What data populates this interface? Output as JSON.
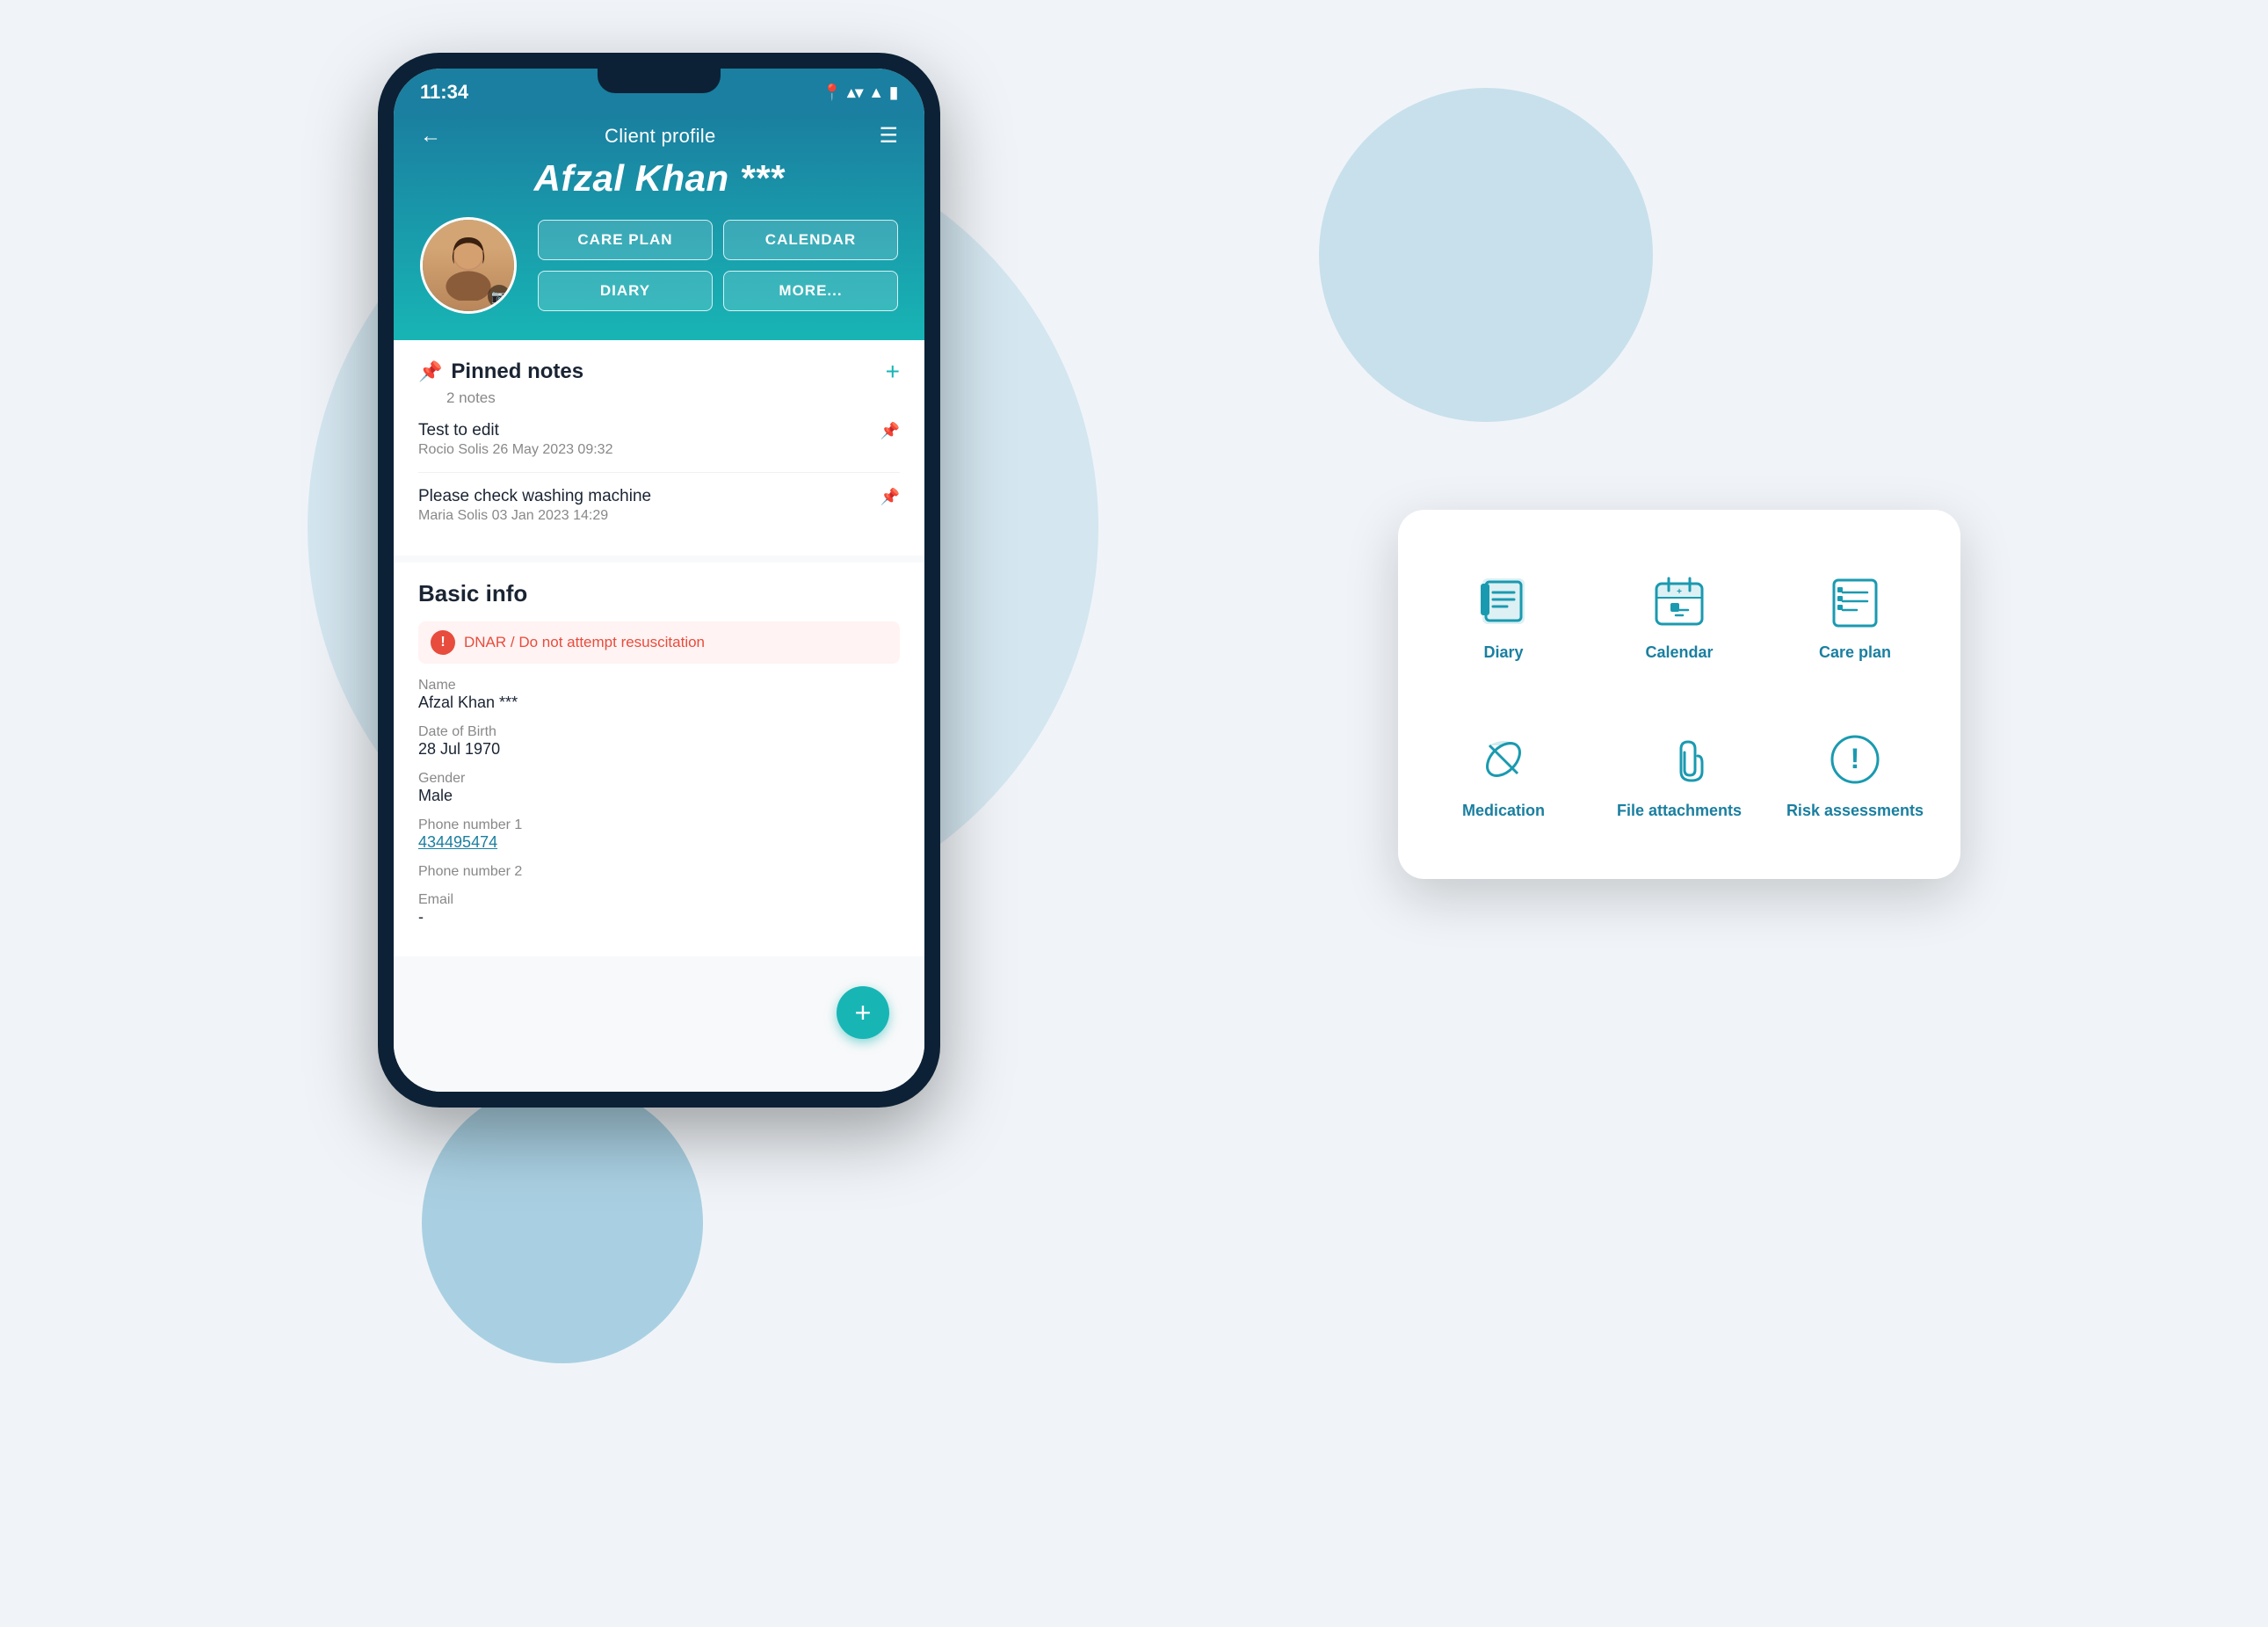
{
  "background": {
    "color": "#e8f2f8"
  },
  "status_bar": {
    "time": "11:34",
    "icons": [
      "📍",
      "▾",
      "📶",
      "🔋"
    ]
  },
  "header": {
    "back_label": "←",
    "title": "Client profile",
    "menu_label": "☰",
    "client_name": "Afzal Khan ***"
  },
  "action_buttons": {
    "care_plan": "CARE PLAN",
    "calendar": "CALENDAR",
    "diary": "DIARY",
    "more": "MORE..."
  },
  "pinned_notes": {
    "section_title": "Pinned notes",
    "subtitle": "2 notes",
    "notes": [
      {
        "title": "Test to edit",
        "meta": "Rocio Solis 26 May 2023 09:32"
      },
      {
        "title": "Please check washing machine",
        "meta": "Maria Solis 03 Jan 2023 14:29"
      }
    ]
  },
  "basic_info": {
    "section_title": "Basic info",
    "dnar_label": "DNAR / Do not attempt resuscitation",
    "fields": [
      {
        "label": "Name",
        "value": "Afzal Khan ***",
        "is_link": false
      },
      {
        "label": "Date of Birth",
        "value": "28 Jul 1970",
        "is_link": false
      },
      {
        "label": "Gender",
        "value": "Male",
        "is_link": false
      },
      {
        "label": "Phone number 1",
        "value": "434495474",
        "is_link": true
      },
      {
        "label": "Phone number 2",
        "value": "",
        "is_link": false
      },
      {
        "label": "Email",
        "value": "-",
        "is_link": false
      }
    ]
  },
  "tablet_menu": {
    "items": [
      {
        "label": "Diary",
        "icon": "diary"
      },
      {
        "label": "Calendar",
        "icon": "calendar"
      },
      {
        "label": "Care plan",
        "icon": "careplan"
      },
      {
        "label": "Medication",
        "icon": "medication"
      },
      {
        "label": "File attachments",
        "icon": "attachment"
      },
      {
        "label": "Risk assessments",
        "icon": "risk"
      }
    ]
  },
  "fab": {
    "label": "+"
  }
}
